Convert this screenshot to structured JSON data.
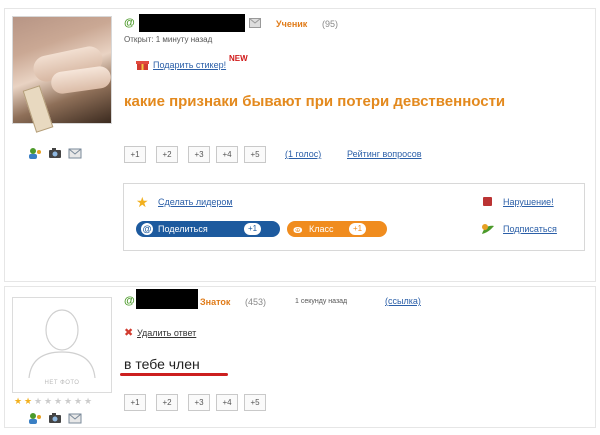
{
  "question": {
    "rank": "Ученик",
    "rank_points": "(95)",
    "opened": "Открыт: 1 минуту назад",
    "gift_sticker": "Подарить стикер!",
    "new_badge": "NEW",
    "text": "какие признаки бывают при потери девственности",
    "votes": [
      "+1",
      "+2",
      "+3",
      "+4",
      "+5"
    ],
    "votes_count_link": "(1 голос)",
    "rating_link": "Рейтинг вопросов",
    "make_leader": "Сделать лидером",
    "violation": "Нарушение!",
    "share_label": "Поделиться",
    "share_count": "+1",
    "class_label": "Класс",
    "class_count": "+1",
    "subscribe": "Подписаться"
  },
  "answer": {
    "rank": "Знаток",
    "rank_points": "(453)",
    "time": "1 секунду назад",
    "link": "(ссылка)",
    "delete": "Удалить ответ",
    "text": "в тебе член",
    "no_photo": "НЕТ ФОТО",
    "votes": [
      "+1",
      "+2",
      "+3",
      "+4",
      "+5"
    ]
  },
  "colors": {
    "question_text": "#e3891d",
    "rank": "#e07b18",
    "link": "#2b5fa8",
    "share_pill": "#1d5a9e",
    "class_pill": "#f08c1e",
    "underline": "#cc1f1f"
  }
}
